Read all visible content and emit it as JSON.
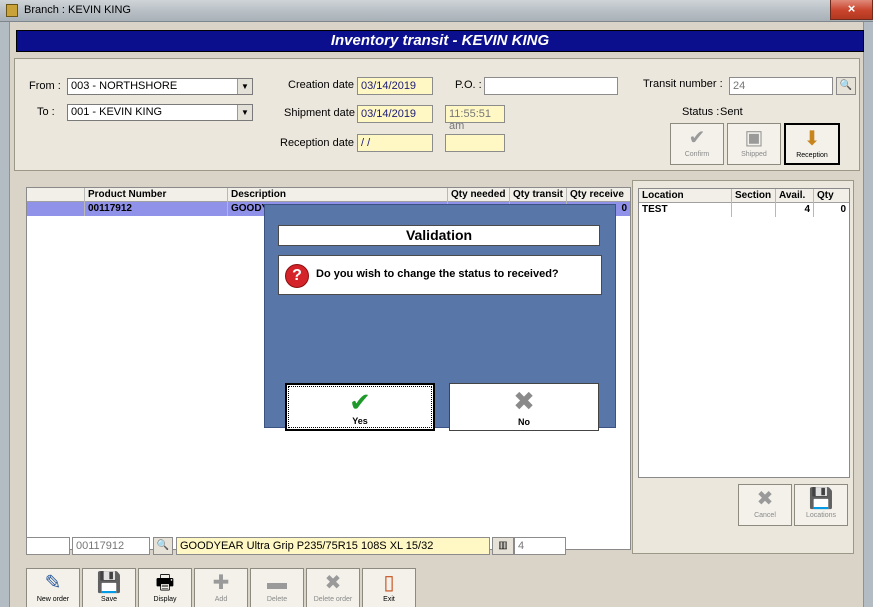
{
  "window": {
    "title": "Branch : KEVIN KING",
    "close_label": "×"
  },
  "banner": {
    "title": "Inventory transit - KEVIN KING"
  },
  "header": {
    "from_label": "From :",
    "from_value": "003 - NORTHSHORE",
    "to_label": "To :",
    "to_value": "001 - KEVIN KING",
    "creation_label": "Creation date :",
    "creation_value": "03/14/2019",
    "shipment_label": "Shipment date :",
    "shipment_value": "03/14/2019",
    "shipment_time": "11:55:51 am",
    "reception_label": "Reception date :",
    "reception_value": " /  /",
    "reception_time": "",
    "po_label": "P.O. :",
    "po_value": "",
    "transit_label": "Transit number :",
    "transit_value": "24",
    "status_label": "Status :",
    "status_value": "Sent"
  },
  "status_buttons": [
    {
      "label": "Confirm",
      "enabled": false
    },
    {
      "label": "Shipped",
      "enabled": false
    },
    {
      "label": "Reception",
      "enabled": true
    }
  ],
  "product_grid": {
    "columns": [
      "Product Number",
      "Description",
      "Qty needed",
      "Qty transit",
      "Qty receive"
    ],
    "rows": [
      {
        "product_number": "00117912",
        "description": "GOODY",
        "qty_needed": "",
        "qty_transit": "",
        "qty_receive": "0"
      }
    ]
  },
  "location_grid": {
    "columns": [
      "Location",
      "Section",
      "Avail.",
      "Qty"
    ],
    "rows": [
      {
        "location": "TEST",
        "section": "",
        "avail": "4",
        "qty": "0"
      }
    ]
  },
  "location_buttons": [
    {
      "label": "Cancel",
      "enabled": false
    },
    {
      "label": "Locations",
      "enabled": false
    }
  ],
  "bottom": {
    "code_value": "",
    "product_value": "00117912",
    "description_value": "GOODYEAR Ultra Grip P235/75R15 108S XL 15/32",
    "qty_value": "4"
  },
  "toolbar": [
    {
      "label": "New order",
      "enabled": true
    },
    {
      "label": "Save",
      "enabled": true
    },
    {
      "label": "Display",
      "enabled": true
    },
    {
      "label": "Add",
      "enabled": false
    },
    {
      "label": "Delete",
      "enabled": false
    },
    {
      "label": "Delete order",
      "enabled": false
    },
    {
      "label": "Exit",
      "enabled": true
    }
  ],
  "dialog": {
    "title": "Validation",
    "message": "Do you wish to change the status to received?",
    "yes_label": "Yes",
    "no_label": "No"
  },
  "colors": {
    "banner": "#0b0f8e",
    "selected_row": "#8f92e8",
    "dialog": "#5976a8",
    "field_yellow": "#fff7c4"
  }
}
